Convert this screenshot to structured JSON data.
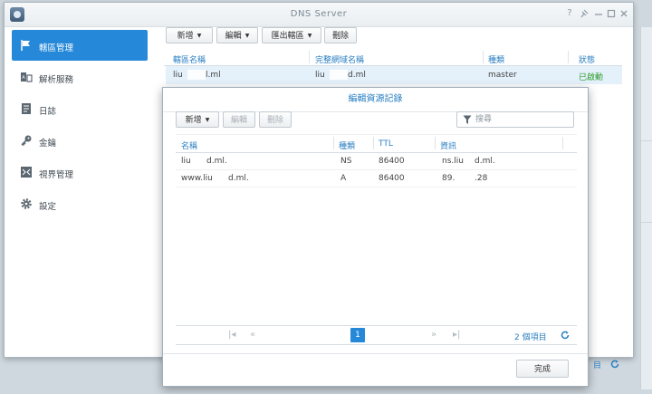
{
  "window": {
    "title": "DNS Server"
  },
  "sidebar": {
    "items": [
      {
        "label": "轄區管理",
        "icon": "flag-icon",
        "active": true
      },
      {
        "label": "解析服務",
        "icon": "resolve-icon",
        "active": false
      },
      {
        "label": "日誌",
        "icon": "log-icon",
        "active": false
      },
      {
        "label": "金鑰",
        "icon": "key-icon",
        "active": false
      },
      {
        "label": "視界管理",
        "icon": "view-icon",
        "active": false
      },
      {
        "label": "設定",
        "icon": "gear-icon",
        "active": false
      }
    ]
  },
  "toolbar": {
    "create": "新增",
    "edit": "編輯",
    "export": "匯出轄區",
    "delete": "刪除"
  },
  "zones": {
    "columns": [
      "轄區名稱",
      "完整網域名稱",
      "種類",
      "狀態"
    ],
    "rows": [
      {
        "zone": "liu",
        "zone_tail": "l.ml",
        "fqdn": "liu",
        "fqdn_tail": "d.ml",
        "type": "master",
        "status": "已啟動"
      }
    ]
  },
  "main_footer": {
    "count_frag": "目"
  },
  "dialog": {
    "title": "編輯資源記錄",
    "create": "新增",
    "edit": "編輯",
    "delete": "刪除",
    "search_placeholder": "搜尋",
    "columns": [
      "名稱",
      "種類",
      "TTL",
      "資訊"
    ],
    "records": [
      {
        "name": "liu",
        "name_tail": "d.ml.",
        "type": "NS",
        "ttl": "86400",
        "info": "ns.liu",
        "info_tail": "d.ml."
      },
      {
        "name": "www.liu",
        "name_tail": "d.ml.",
        "type": "A",
        "ttl": "86400",
        "info": "89.",
        "info_tail": ".28"
      }
    ],
    "pager": {
      "current": "1",
      "count": "2 個項目"
    },
    "done": "完成"
  }
}
